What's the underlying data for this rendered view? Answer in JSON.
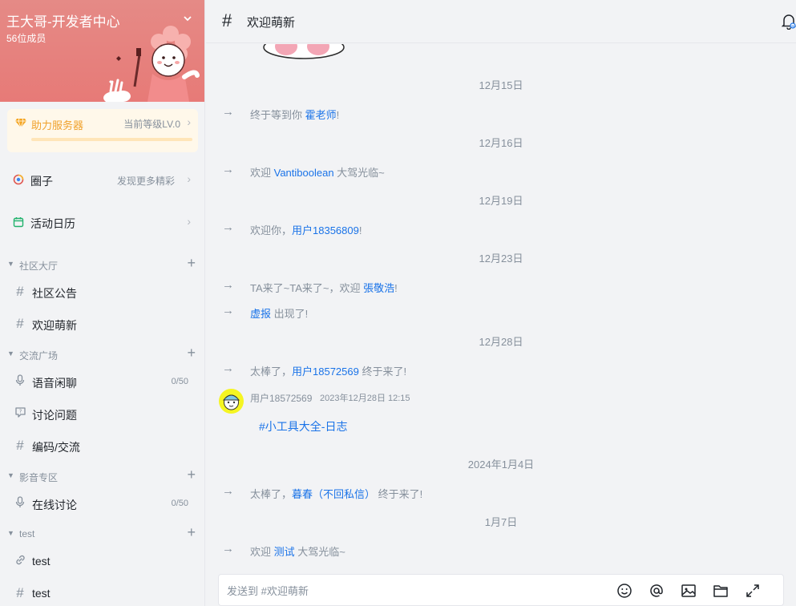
{
  "server": {
    "name": "王大哥-开发者中心",
    "members": "56位成员"
  },
  "boost": {
    "label": "助力服务器",
    "level": "当前等级LV.0",
    "progress": 0
  },
  "nav": [
    {
      "label": "圈子",
      "hint": "发现更多精彩",
      "icon": "circle-icon"
    },
    {
      "label": "活动日历",
      "hint": "",
      "icon": "calendar-icon"
    }
  ],
  "groups": [
    {
      "name": "社区大厅",
      "channels": [
        {
          "name": "社区公告",
          "icon": "hash-icon",
          "count": ""
        },
        {
          "name": "欢迎萌新",
          "icon": "hash-icon",
          "count": ""
        }
      ]
    },
    {
      "name": "交流广场",
      "channels": [
        {
          "name": "语音闲聊",
          "icon": "mic-icon",
          "count": "0/50"
        },
        {
          "name": "讨论问题",
          "icon": "question-icon",
          "count": ""
        },
        {
          "name": "编码/交流",
          "icon": "hash-icon",
          "count": ""
        }
      ]
    },
    {
      "name": "影音专区",
      "channels": [
        {
          "name": "在线讨论",
          "icon": "mic-icon",
          "count": "0/50"
        }
      ]
    },
    {
      "name": "test",
      "channels": [
        {
          "name": "test",
          "icon": "link-icon",
          "count": ""
        },
        {
          "name": "test",
          "icon": "hash-icon",
          "count": ""
        }
      ]
    }
  ],
  "channel": {
    "title": "欢迎萌新"
  },
  "messages": [
    {
      "date": "12月15日",
      "before": "终于等到你 ",
      "name": "霍老师",
      "after": "!"
    },
    {
      "date": "12月16日",
      "before": "欢迎 ",
      "name": "Vantiboolean",
      "after": " 大驾光临~"
    },
    {
      "date": "12月19日",
      "before": "欢迎你，",
      "name": "用户18356809",
      "after": "!"
    },
    {
      "date": "12月23日",
      "before": "TA来了~TA来了~，欢迎 ",
      "name": "張敬浩",
      "after": "!"
    },
    {
      "before": "",
      "name": "虚报",
      "after": " 出现了!"
    },
    {
      "date": "12月28日",
      "before": "太棒了，",
      "name": "用户18572569",
      "after": " 终于来了!"
    },
    {
      "date": "2024年1月4日",
      "before": "太棒了，",
      "name": "暮春（不回私信）",
      "after": " 终于来了!"
    },
    {
      "date": "1月7日",
      "before": "欢迎 ",
      "name": "测试",
      "after": " 大驾光临~"
    }
  ],
  "user_message": {
    "username": "用户18572569",
    "time": "2023年12月28日 12:15",
    "link": "#小工具大全-日志"
  },
  "composer": {
    "placeholder": "发送到 #欢迎萌新"
  },
  "icons": [
    "emoji-icon",
    "mention-icon",
    "image-icon",
    "folder-icon",
    "expand-icon",
    "bell-icon"
  ]
}
